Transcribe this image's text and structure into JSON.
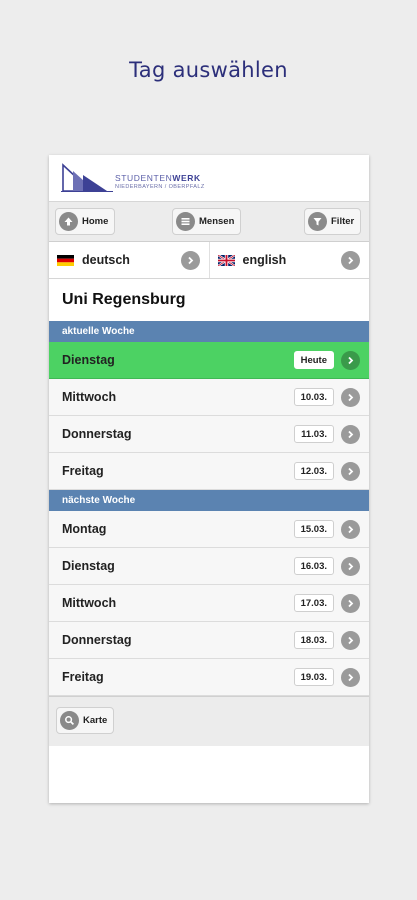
{
  "caption": "Tag auswählen",
  "logo": {
    "line1_a": "STUDENTEN",
    "line1_b": "WERK",
    "line2": "NIEDERBAYERN / OBERPFALZ"
  },
  "toolbar": {
    "home": "Home",
    "mensen": "Mensen",
    "filter": "Filter"
  },
  "languages": [
    {
      "label": "deutsch",
      "flag": "de-flag-icon"
    },
    {
      "label": "english",
      "flag": "uk-flag-icon"
    }
  ],
  "title": "Uni Regensburg",
  "sections": {
    "current": "aktuelle Woche",
    "next": "nächste Woche"
  },
  "current_week": [
    {
      "day": "Dienstag",
      "date": "Heute",
      "active": true
    },
    {
      "day": "Mittwoch",
      "date": "10.03."
    },
    {
      "day": "Donnerstag",
      "date": "11.03."
    },
    {
      "day": "Freitag",
      "date": "12.03."
    }
  ],
  "next_week": [
    {
      "day": "Montag",
      "date": "15.03."
    },
    {
      "day": "Dienstag",
      "date": "16.03."
    },
    {
      "day": "Mittwoch",
      "date": "17.03."
    },
    {
      "day": "Donnerstag",
      "date": "18.03."
    },
    {
      "day": "Freitag",
      "date": "19.03."
    }
  ],
  "footer": {
    "karte": "Karte"
  },
  "colors": {
    "accent_green": "#4cd263",
    "section_blue": "#5b83b1",
    "caption": "#2c2f7a"
  }
}
